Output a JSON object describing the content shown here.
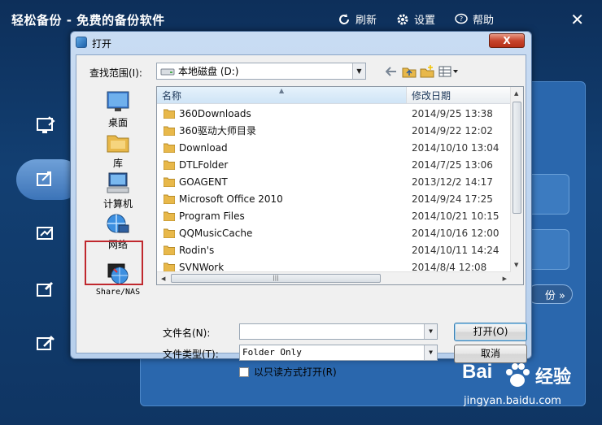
{
  "app": {
    "title": "轻松备份 - 免费的备份软件",
    "actions": [
      {
        "label": "刷新",
        "icon": "refresh-icon"
      },
      {
        "label": "设置",
        "icon": "gear-icon"
      },
      {
        "label": "帮助",
        "icon": "help-icon"
      }
    ],
    "close": "✕",
    "next_label": "份 »"
  },
  "dialog": {
    "title": "打开",
    "close": "X",
    "look_in_label": "查找范围(I):",
    "look_in_value": "本地磁盘 (D:)",
    "places": [
      {
        "label": "桌面",
        "icon": "desktop-icon"
      },
      {
        "label": "库",
        "icon": "library-icon"
      },
      {
        "label": "计算机",
        "icon": "computer-icon"
      },
      {
        "label": "网络",
        "icon": "network-icon"
      },
      {
        "label": "Share/NAS",
        "icon": "share-nas-icon"
      }
    ],
    "columns": {
      "name": "名称",
      "date": "修改日期"
    },
    "files": [
      {
        "name": "360Downloads",
        "date": "2014/9/25 13:38"
      },
      {
        "name": "360驱动大师目录",
        "date": "2014/9/22 12:02"
      },
      {
        "name": "Download",
        "date": "2014/10/10 13:04"
      },
      {
        "name": "DTLFolder",
        "date": "2014/7/25 13:06"
      },
      {
        "name": "GOAGENT",
        "date": "2013/12/2 14:17"
      },
      {
        "name": "Microsoft Office 2010",
        "date": "2014/9/24 17:25"
      },
      {
        "name": "Program Files",
        "date": "2014/10/21 10:15"
      },
      {
        "name": "QQMusicCache",
        "date": "2014/10/16 12:00"
      },
      {
        "name": "Rodin's",
        "date": "2014/10/11 14:24"
      },
      {
        "name": "SVNWork",
        "date": "2014/8/4 12:08"
      }
    ],
    "filename_label": "文件名(N):",
    "filename_value": "",
    "filetype_label": "文件类型(T):",
    "filetype_value": "Folder Only",
    "open_button": "打开(O)",
    "cancel_button": "取消",
    "readonly_label": "以只读方式打开(R)"
  },
  "watermark": {
    "brand": "Bai",
    "text": "经验",
    "url": "jingyan.baidu.com"
  },
  "colors": {
    "accent": "#2a67ad",
    "highlight": "#c0282e",
    "folder": "#e8b84a"
  }
}
